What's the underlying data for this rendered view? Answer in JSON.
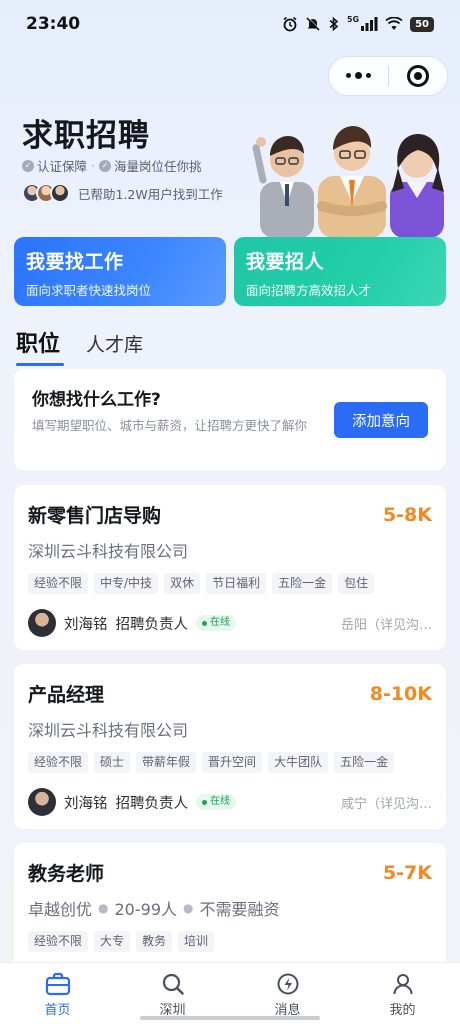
{
  "status": {
    "time": "23:40",
    "battery": "50",
    "network": "5G"
  },
  "hero": {
    "title": "求职招聘",
    "feature1": "认证保障",
    "feature_sep": "·",
    "feature2": "海量岗位任你挑",
    "help_text": "已帮助1.2W用户找到工作"
  },
  "cta": {
    "find": {
      "title": "我要找工作",
      "subtitle": "面向求职者快速找岗位"
    },
    "hire": {
      "title": "我要招人",
      "subtitle": "面向招聘方高效招人才"
    }
  },
  "tabs": {
    "jobs": "职位",
    "talent": "人才库"
  },
  "intent": {
    "title": "你想找什么工作?",
    "desc": "填写期望职位、城市与薪资，让招聘方更快了解你",
    "button": "添加意向"
  },
  "jobs": [
    {
      "title": "新零售门店导购",
      "salary": "5-8K",
      "company": "深圳云斗科技有限公司",
      "tags": [
        "经验不限",
        "中专/中技",
        "双休",
        "节日福利",
        "五险一金",
        "包住"
      ],
      "recruiter": "刘海铭",
      "role": "招聘负责人",
      "online": "在线",
      "location": "岳阳（详见沟…"
    },
    {
      "title": "产品经理",
      "salary": "8-10K",
      "company": "深圳云斗科技有限公司",
      "tags": [
        "经验不限",
        "硕士",
        "带薪年假",
        "晋升空间",
        "大牛团队",
        "五险一金"
      ],
      "recruiter": "刘海铭",
      "role": "招聘负责人",
      "online": "在线",
      "location": "咸宁（详见沟…"
    },
    {
      "title": "教务老师",
      "salary": "5-7K",
      "company": "卓越创优",
      "company_size": "20-99人",
      "company_funding": "不需要融资",
      "tags": [
        "经验不限",
        "大专",
        "教务",
        "培训"
      ]
    }
  ],
  "tabbar": {
    "home": "首页",
    "city": "深圳",
    "messages": "消息",
    "mine": "我的"
  },
  "colors": {
    "primary": "#2a6cf6",
    "find_card": "#2a74ff",
    "hire_card": "#1fc6a6",
    "salary": "#f08a22",
    "online": "#19a35a"
  }
}
